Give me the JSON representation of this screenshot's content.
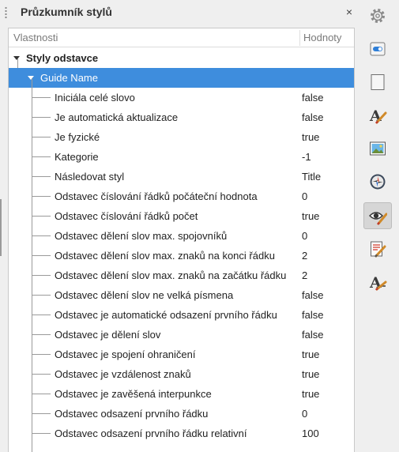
{
  "deck": {
    "title": "Průzkumník stylů",
    "close_glyph": "×"
  },
  "tree": {
    "header": {
      "properties": "Vlastnosti",
      "values": "Hodnoty"
    },
    "group_label": "Styly odstavce",
    "selected_label": "Guide Name",
    "rows": [
      {
        "name": "Iniciála celé slovo",
        "value": "false"
      },
      {
        "name": "Je automatická aktualizace",
        "value": "false"
      },
      {
        "name": "Je fyzické",
        "value": "true"
      },
      {
        "name": "Kategorie",
        "value": "-1"
      },
      {
        "name": "Následovat styl",
        "value": "Title"
      },
      {
        "name": "Odstavec číslování řádků počáteční hodnota",
        "value": "0"
      },
      {
        "name": "Odstavec číslování řádků počet",
        "value": "true"
      },
      {
        "name": "Odstavec dělení slov max. spojovníků",
        "value": "0"
      },
      {
        "name": "Odstavec dělení slov max. znaků na konci řádku",
        "value": "2"
      },
      {
        "name": "Odstavec dělení slov max. znaků na začátku řádku",
        "value": "2"
      },
      {
        "name": "Odstavec dělení slov ne velká písmena",
        "value": "false"
      },
      {
        "name": "Odstavec je automatické odsazení prvního řádku",
        "value": "false"
      },
      {
        "name": "Odstavec je dělení slov",
        "value": "false"
      },
      {
        "name": "Odstavec je spojení ohraničení",
        "value": "true"
      },
      {
        "name": "Odstavec je vzdálenost znaků",
        "value": "true"
      },
      {
        "name": "Odstavec je zavěšená interpunkce",
        "value": "true"
      },
      {
        "name": "Odstavec odsazení prvního řádku",
        "value": "0"
      },
      {
        "name": "Odstavec odsazení prvního řádku relativní",
        "value": "100"
      }
    ]
  },
  "sidebar_tabs": [
    {
      "icon": "gear-icon"
    },
    {
      "icon": "properties-toggle-icon"
    },
    {
      "icon": "page-icon"
    },
    {
      "icon": "styles-icon"
    },
    {
      "icon": "gallery-icon"
    },
    {
      "icon": "navigator-icon"
    },
    {
      "icon": "style-inspector-icon",
      "active": true
    },
    {
      "icon": "manage-changes-icon"
    },
    {
      "icon": "design-icon"
    }
  ]
}
